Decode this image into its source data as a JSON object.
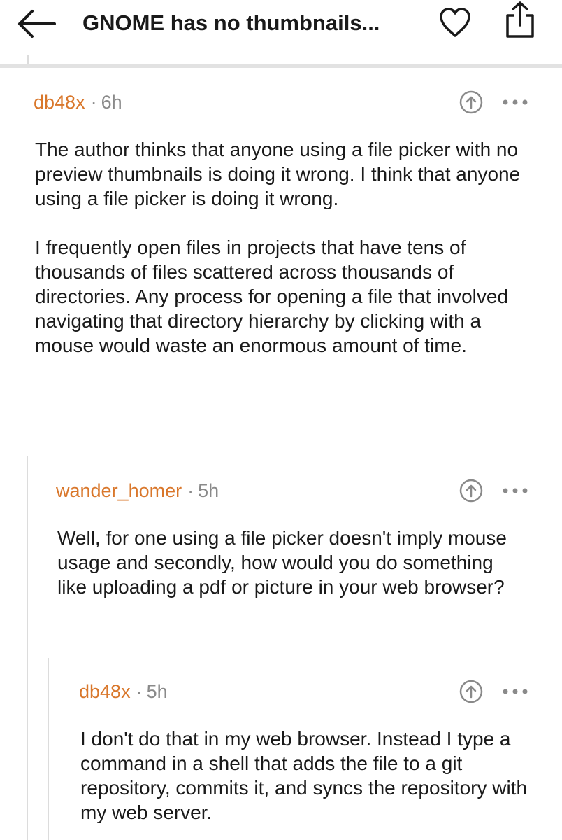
{
  "header": {
    "title": "GNOME has no thumbnails...",
    "back_icon": "arrow-left-icon",
    "favorite_icon": "heart-icon",
    "share_icon": "share-icon"
  },
  "colors": {
    "author": "#d9772b",
    "meta": "#8a8a8a",
    "text": "#1a1a1a",
    "thread_line": "#dcdcdc"
  },
  "comments": [
    {
      "author": "db48x",
      "separator": "·",
      "time": "6h",
      "paragraphs": [
        "The author thinks that anyone using a file picker with no preview thumbnails is doing it wrong. I think that anyone using a file picker is doing it wrong.",
        "I frequently open files in projects that have tens of thousands of files scattered across thousands of directories. Any process for opening a file that involved navigating that directory hierarchy by clicking with a mouse would waste an enormous amount of time."
      ]
    },
    {
      "author": "wander_homer",
      "separator": "·",
      "time": "5h",
      "paragraphs": [
        "Well, for one using a file picker doesn't imply mouse usage and secondly, how would you do something like uploading a pdf or picture in your web browser?"
      ]
    },
    {
      "author": "db48x",
      "separator": "·",
      "time": "5h",
      "paragraphs": [
        "I don't do that in my web browser. Instead I type a command in a shell that adds the file to a git repository, commits it, and syncs the repository with my web server."
      ]
    }
  ]
}
